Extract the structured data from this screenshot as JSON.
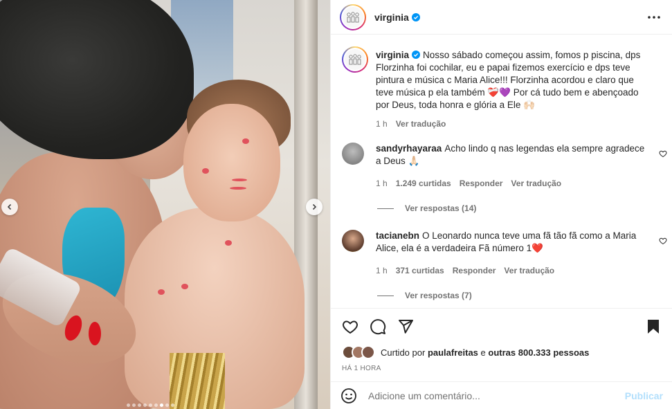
{
  "post": {
    "username": "virginia",
    "caption": "Nosso sábado começou assim, fomos p piscina, dps Florzinha foi cochilar, eu e papai fizemos exercício e dps teve pintura e música c Maria Alice!!! Florzinha acordou e claro que teve música p ela também ❤️‍🩹💜 Por cá tudo bem e abençoado por Deus, toda honra e glória a Ele 🙌🏻",
    "caption_time": "1 h",
    "translate": "Ver tradução"
  },
  "media": {
    "slide_count": 9,
    "active_slide": 6
  },
  "comments": [
    {
      "username": "sandyrhayaraa",
      "text": "Acho lindo q nas legendas ela sempre agradece a Deus 🙏🏻",
      "time": "1 h",
      "likes": "1.249 curtidas",
      "reply": "Responder",
      "translate": "Ver tradução",
      "replies": "Ver respostas (14)",
      "avatar_color": "#8a8a8a"
    },
    {
      "username": "tacianebn",
      "text": "O Leonardo nunca teve uma fã tão fã como a Maria Alice, ela é a verdadeira Fã número 1❤️",
      "time": "1 h",
      "likes": "371 curtidas",
      "reply": "Responder",
      "translate": "Ver tradução",
      "replies": "Ver respostas (7)",
      "avatar_color": "#6b4a3a"
    }
  ],
  "likes": {
    "prefix": "Curtido por",
    "user": "paulafreitas",
    "middle": "e",
    "others": "outras 800.333 pessoas"
  },
  "timestamp": "HÁ 1 HORA",
  "add_comment": {
    "placeholder": "Adicione um comentário...",
    "publish": "Publicar"
  },
  "colors": {
    "verified": "#0095f6",
    "publish_disabled": "#b2dffc",
    "meta": "#737373"
  },
  "icons": [
    "more-icon",
    "heart-icon",
    "comment-icon",
    "share-icon",
    "bookmark-icon",
    "emoji-icon",
    "verified-icon",
    "chevron-left-icon",
    "chevron-right-icon"
  ]
}
